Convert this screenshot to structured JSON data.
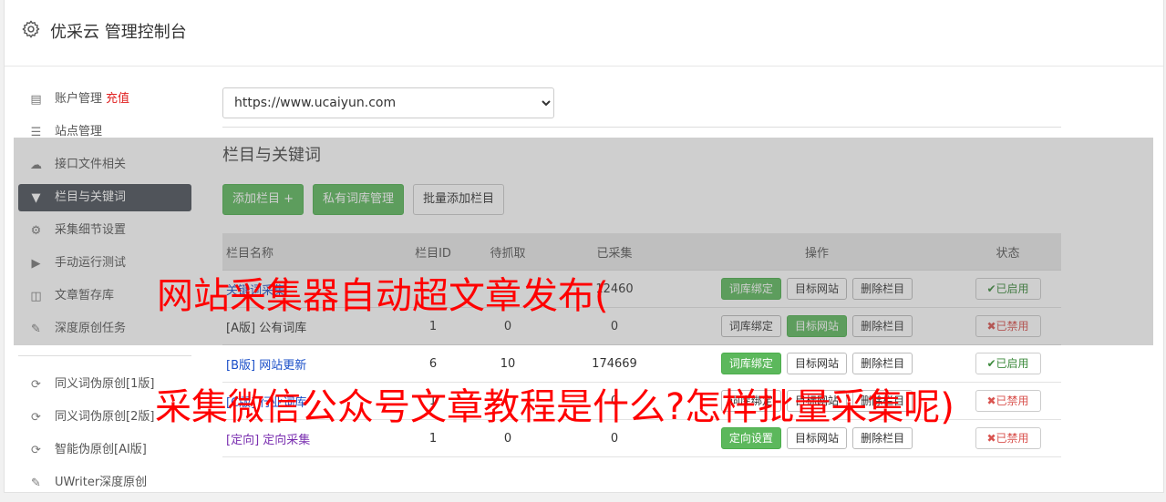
{
  "header": {
    "title": "优采云 管理控制台"
  },
  "sidebar": {
    "items": [
      {
        "label": "账户管理",
        "icon": "bar-chart-icon",
        "extra": "充值"
      },
      {
        "label": "站点管理",
        "icon": "server-icon"
      },
      {
        "label": "接口文件相关",
        "icon": "cloud-upload-icon"
      },
      {
        "label": "栏目与关键词",
        "icon": "filter-icon",
        "active": true
      },
      {
        "label": "采集细节设置",
        "icon": "cogs-icon"
      },
      {
        "label": "手动运行测试",
        "icon": "play-icon"
      },
      {
        "label": "文章暂存库",
        "icon": "database-icon"
      },
      {
        "label": "深度原创任务",
        "icon": "edit-icon"
      }
    ],
    "items2": [
      {
        "label": "同义词伪原创[1版]",
        "icon": "refresh-icon"
      },
      {
        "label": "同义词伪原创[2版]",
        "icon": "refresh-icon"
      },
      {
        "label": "智能伪原创[AI版]",
        "icon": "refresh-icon"
      },
      {
        "label": "UWriter深度原创",
        "icon": "edit-icon"
      }
    ]
  },
  "main": {
    "site_select": "https://www.ucaiyun.com",
    "section_title": "栏目与关键词",
    "buttons": {
      "add": "添加栏目 +",
      "private_lib": "私有词库管理",
      "batch_add": "批量添加栏目"
    },
    "table": {
      "headers": [
        "栏目名称",
        "栏目ID",
        "待抓取",
        "已采集",
        "操作",
        "状态"
      ],
      "rows": [
        {
          "tag": "",
          "name": "关键词采集",
          "id": "",
          "pending": "",
          "collected": "12460",
          "op1": "词库绑定",
          "op2": "目标网站",
          "op3": "删除栏目",
          "status": "已启用",
          "status_on": true
        },
        {
          "tag": "[A版]",
          "name": "公有词库",
          "id": "1",
          "pending": "0",
          "collected": "0",
          "op1": "词库绑定",
          "op2": "目标网站",
          "op3": "删除栏目",
          "status": "已禁用",
          "status_on": false
        },
        {
          "tag": "[B版]",
          "name": "网站更新",
          "id": "6",
          "pending": "10",
          "collected": "174669",
          "op1": "词库绑定",
          "op2": "目标网站",
          "op3": "删除栏目",
          "status": "已启用",
          "status_on": true
        },
        {
          "tag": "[C版]",
          "name": "行业词库",
          "id": "1",
          "pending": "",
          "collected": "0",
          "op1": "词库绑定",
          "op2": "目标网站",
          "op3": "删除栏目",
          "status": "已禁用",
          "status_on": false
        },
        {
          "tag": "[定向]",
          "name": "定向采集",
          "id": "1",
          "pending": "0",
          "collected": "0",
          "op1": "定向设置",
          "op2": "目标网站",
          "op3": "删除栏目",
          "status": "已禁用",
          "status_on": false
        }
      ]
    }
  },
  "overlay": {
    "line1": "网站采集器自动超文章发布(",
    "line2": "采集微信公众号文章教程是什么?怎样批量采集呢)"
  },
  "colors": {
    "accent_green": "#5cb85c",
    "active_sidebar": "#4a5058",
    "overlay_text": "#ff0000",
    "link_blue": "#1a4fc8"
  }
}
